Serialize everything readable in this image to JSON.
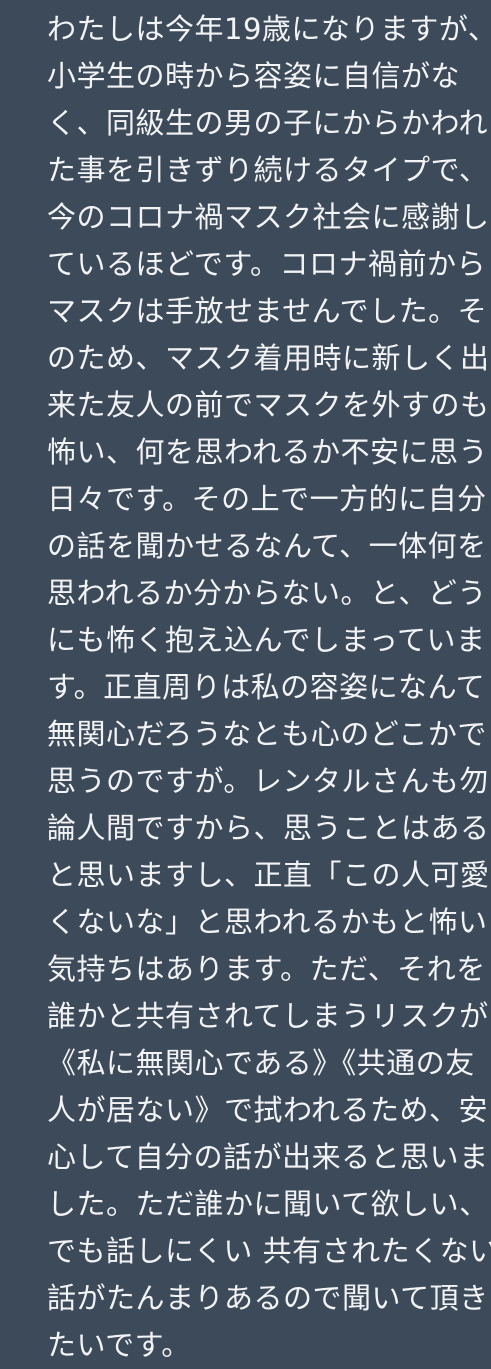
{
  "message": {
    "lines": [
      "わたしは今年19歳になりますが、",
      "小学生の時から容姿に自信がな",
      "く、同級生の男の子にからかわれ",
      "た事を引きずり続けるタイプで、",
      "今のコロナ禍マスク社会に感謝し",
      "ているほどです。コロナ禍前から",
      "マスクは手放せませんでした。そ",
      "のため、マスク着用時に新しく出",
      "来た友人の前でマスクを外すのも",
      "怖い、何を思われるか不安に思う",
      "日々です。その上で一方的に自分",
      "の話を聞かせるなんて、一体何を",
      "思われるか分からない。と、どう",
      "にも怖く抱え込んでしまっていま",
      "す。正直周りは私の容姿になんて",
      "無関心だろうなとも心のどこかで",
      "思うのですが。レンタルさんも勿",
      "論人間ですから、思うことはある",
      "と思いますし、正直「この人可愛",
      "くないな」と思われるかもと怖い",
      "気持ちはあります。ただ、それを",
      "誰かと共有されてしまうリスクが",
      "《私に無関心である》《共通の友",
      "人が居ない》で拭われるため、安",
      "心して自分の話が出来ると思いま",
      "した。ただ誰かに聞いて欲しい、",
      "でも話しにくい 共有されたくない",
      "話がたんまりあるので聞いて頂き",
      "たいです。"
    ]
  }
}
